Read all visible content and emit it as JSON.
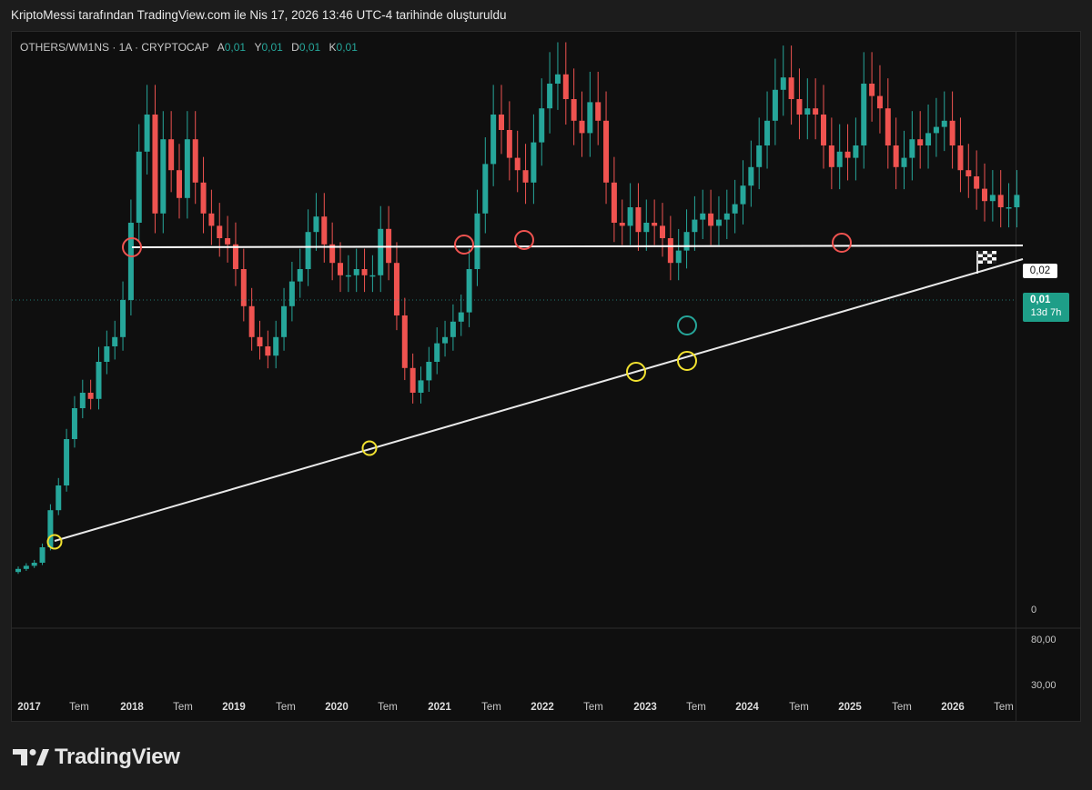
{
  "header": {
    "title": "KriptoMessi tarafından TradingView.com ile Nis 17, 2026 13:46 UTC-4 tarihinde oluşturuldu"
  },
  "legend": {
    "symbol": "OTHERS/WM1NS · 1A · CRYPTOCAP",
    "ohlc": [
      {
        "k": "A",
        "v": "0,01"
      },
      {
        "k": "Y",
        "v": "0,01"
      },
      {
        "k": "D",
        "v": "0,01"
      },
      {
        "k": "K",
        "v": "0,01"
      }
    ]
  },
  "price_scale": {
    "upper_tag": "0,02",
    "current_value": "0,01",
    "current_countdown": "13d 7h",
    "zero_label": "0",
    "volume_labels": [
      "80,00",
      "30,00"
    ]
  },
  "colors": {
    "up": "#26a69a",
    "down": "#ef5350",
    "resistance_marker": "#ef5350",
    "support_marker": "#f2e230",
    "teal_marker": "#26a69a",
    "trendline": "#ffffff"
  },
  "icons": {
    "finish_flag": "checkered-flag-icon",
    "logo": "tradingview-logo-icon"
  },
  "watermark": "TradingView",
  "chart_data": {
    "type": "candlestick",
    "title": "OTHERS/WM1NS · 1A · CRYPTOCAP",
    "interval": "1A",
    "x_labels": [
      "2017",
      "Tem",
      "2018",
      "Tem",
      "2019",
      "Tem",
      "2020",
      "Tem",
      "2021",
      "Tem",
      "2022",
      "Tem",
      "2023",
      "Tem",
      "2024",
      "Tem",
      "2025",
      "Tem",
      "2026",
      "Tem"
    ],
    "y_labels": [
      "0,02",
      "0,01",
      "0"
    ],
    "ylim": [
      0,
      0.022
    ],
    "grid": false,
    "closes": [
      0.0013,
      0.0014,
      0.0015,
      0.002,
      0.0032,
      0.004,
      0.0055,
      0.0065,
      0.007,
      0.0068,
      0.008,
      0.0085,
      0.0088,
      0.01,
      0.0125,
      0.0148,
      0.016,
      0.0128,
      0.0152,
      0.0142,
      0.0133,
      0.0152,
      0.0138,
      0.0128,
      0.0124,
      0.012,
      0.0118,
      0.011,
      0.0098,
      0.0088,
      0.0085,
      0.0082,
      0.0088,
      0.0098,
      0.0106,
      0.011,
      0.0122,
      0.0127,
      0.0118,
      0.0112,
      0.0108,
      0.0108,
      0.011,
      0.0108,
      0.0108,
      0.0123,
      0.0112,
      0.0095,
      0.0078,
      0.007,
      0.0074,
      0.008,
      0.0086,
      0.0088,
      0.0093,
      0.0096,
      0.011,
      0.0128,
      0.0144,
      0.016,
      0.0155,
      0.0146,
      0.0142,
      0.0138,
      0.0151,
      0.0162,
      0.017,
      0.0173,
      0.0165,
      0.0158,
      0.0154,
      0.0164,
      0.0158,
      0.0138,
      0.0125,
      0.0124,
      0.013,
      0.0122,
      0.0125,
      0.0124,
      0.012,
      0.0112,
      0.0116,
      0.0122,
      0.0126,
      0.0128,
      0.0124,
      0.0126,
      0.0128,
      0.0131,
      0.0137,
      0.0143,
      0.015,
      0.0158,
      0.0168,
      0.0172,
      0.0165,
      0.016,
      0.0162,
      0.016,
      0.015,
      0.0143,
      0.0148,
      0.0146,
      0.015,
      0.017,
      0.0166,
      0.0162,
      0.015,
      0.0143,
      0.0146,
      0.0152,
      0.015,
      0.0154,
      0.0156,
      0.0158,
      0.015,
      0.0142,
      0.014,
      0.0136,
      0.0132,
      0.0134,
      0.013,
      0.013,
      0.0134
    ],
    "start_open": 0.0012
  }
}
